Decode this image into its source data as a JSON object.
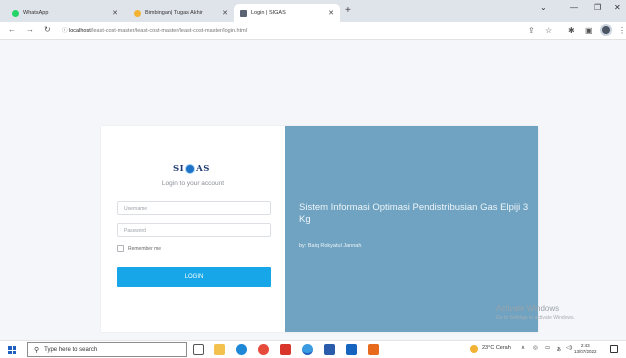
{
  "browser": {
    "tabs": [
      {
        "label": "WhatsApp",
        "icon": "whatsapp-icon",
        "color": "#25d366"
      },
      {
        "label": "Bimbingan| Tugas Akhir",
        "icon": "bimbingan-icon",
        "color": "#f2b233"
      },
      {
        "label": "Login | SIGAS",
        "icon": "sigas-page-icon",
        "color": "#5a6472"
      }
    ],
    "url_host": "localhost",
    "url_path": "/least-cost-master/least-cost-master/least-cost-master/login.html"
  },
  "login": {
    "logo_left": "SI",
    "logo_right": "AS",
    "subtitle": "Login to your account",
    "username_placeholder": "Username",
    "password_placeholder": "Password",
    "remember_label": "Remember me",
    "button_label": "LOGIN"
  },
  "hero": {
    "title": "Sistem Informasi Optimasi Pendistribusian Gas Elpiji 3 Kg",
    "byline": "by: Baiq Rokyatul Jannah",
    "background": "#6fa3c1"
  },
  "watermark": {
    "title": "Activate Windows",
    "subtitle": "Go to Settings to activate Windows."
  },
  "taskbar": {
    "search_placeholder": "Type here to search",
    "weather": "23°C  Cerah",
    "time": "2:43",
    "date": "13/07/2022"
  },
  "colors": {
    "accent": "#17a7e8",
    "page_bg": "#f4f6f9"
  }
}
